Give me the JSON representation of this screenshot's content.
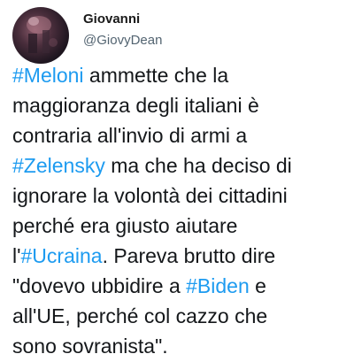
{
  "author": {
    "display_name": "Giovanni",
    "handle": "@GiovyDean",
    "avatar_icon": "profile-photo-avatar"
  },
  "colors": {
    "text": "#14171a",
    "secondary_text": "#536471",
    "hashtag": "#1d9bf0",
    "background": "#ffffff"
  },
  "tweet": {
    "lines": [
      [
        {
          "t": "#Meloni",
          "tag": true
        },
        {
          "t": " ammette che la"
        }
      ],
      [
        {
          "t": "maggioranza degli italiani è"
        }
      ],
      [
        {
          "t": "contraria all'invio di armi a"
        }
      ],
      [
        {
          "t": "#Zelensky",
          "tag": true
        },
        {
          "t": " ma che ha deciso di"
        }
      ],
      [
        {
          "t": "ignorare la volontà dei cittadini"
        }
      ],
      [
        {
          "t": "perché era giusto aiutare"
        }
      ],
      [
        {
          "t": "l'"
        },
        {
          "t": "#Ucraina",
          "tag": true
        },
        {
          "t": ". Pareva brutto dire"
        }
      ],
      [
        {
          "t": "\"dovevo ubbidire a "
        },
        {
          "t": "#Biden",
          "tag": true
        },
        {
          "t": " e"
        }
      ],
      [
        {
          "t": "all'UE, perché col cazzo che"
        }
      ],
      [
        {
          "t": "sono sovranista\"."
        }
      ]
    ]
  }
}
